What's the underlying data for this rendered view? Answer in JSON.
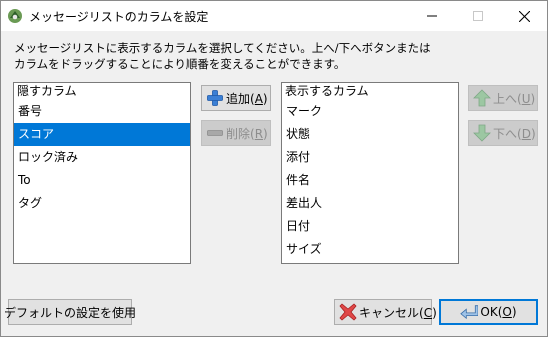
{
  "window": {
    "title": "メッセージリストのカラムを設定",
    "icon": "app-icon",
    "controls": {
      "minimize": "minimize-icon",
      "maximize": "maximize-icon",
      "close": "close-icon"
    }
  },
  "instructions": {
    "line1": "メッセージリストに表示するカラムを選択してください。上へ/下へボタンまたは",
    "line2": "カラムをドラッグすることにより順番を変えることができます。"
  },
  "hidden_columns": {
    "header": "隠すカラム",
    "items": [
      "番号",
      "スコア",
      "ロック済み",
      "To",
      "タグ"
    ],
    "selected": "スコア"
  },
  "shown_columns": {
    "header": "表示するカラム",
    "items": [
      "マーク",
      "状態",
      "添付",
      "件名",
      "差出人",
      "日付",
      "サイズ"
    ]
  },
  "buttons": {
    "add": {
      "label": "追加(A)",
      "text": "追加(",
      "mnemonic": "A",
      "close": ")",
      "enabled": true
    },
    "remove": {
      "label": "削除(R)",
      "text": "削除(",
      "mnemonic": "R",
      "close": ")",
      "enabled": false
    },
    "up": {
      "label": "上へ(U)",
      "text": "上へ(",
      "mnemonic": "U",
      "close": ")",
      "enabled": false
    },
    "down": {
      "label": "下へ(D)",
      "text": "下へ(",
      "mnemonic": "D",
      "close": ")",
      "enabled": false
    },
    "use_default": {
      "label": "デフォルトの設定を使用"
    },
    "cancel": {
      "label": "キャンセル(C)",
      "text": "キャンセル(",
      "mnemonic": "C",
      "close": ")"
    },
    "ok": {
      "label": "OK(O)",
      "text": "OK(",
      "mnemonic": "O",
      "close": ")",
      "default": true
    }
  },
  "colors": {
    "selection": "#0078d7",
    "add_icon": "#3a7fd5",
    "cancel_icon": "#d83a3a",
    "arrow_icon": "#7fb58a"
  }
}
